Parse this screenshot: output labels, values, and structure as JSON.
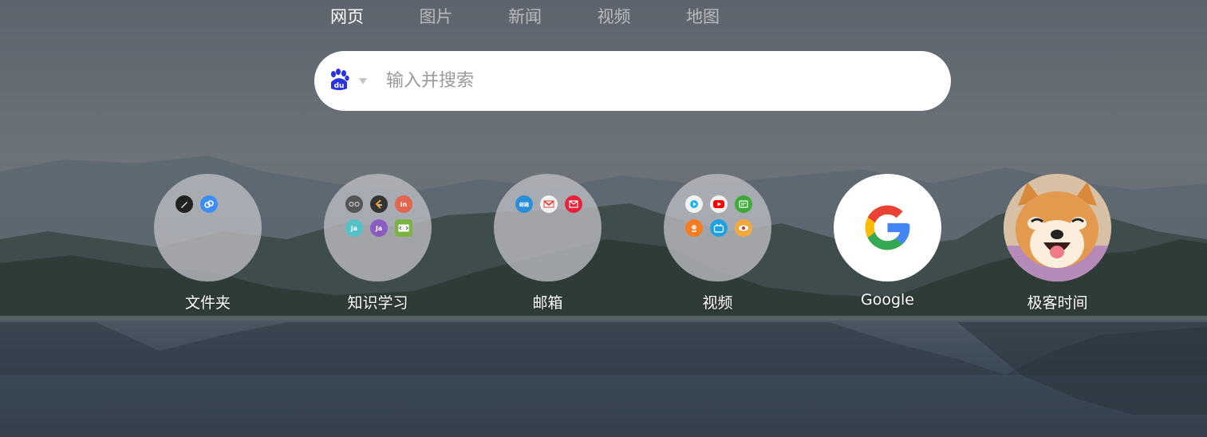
{
  "nav": {
    "tabs": [
      {
        "label": "网页",
        "active": true
      },
      {
        "label": "图片",
        "active": false
      },
      {
        "label": "新闻",
        "active": false
      },
      {
        "label": "视频",
        "active": false
      },
      {
        "label": "地图",
        "active": false
      }
    ]
  },
  "search": {
    "engine_icon": "baidu-paw-icon",
    "placeholder": "输入并搜索",
    "value": ""
  },
  "shortcuts": [
    {
      "label": "文件夹",
      "type": "folder",
      "icons": [
        "pen-icon",
        "cloud-link-icon"
      ]
    },
    {
      "label": "知识学习",
      "type": "folder",
      "icons": [
        "glasses-icon",
        "leetcode-icon",
        "in",
        "ja",
        "Ja",
        "code-icon"
      ],
      "mini_text": {
        "in": "in",
        "ja": "ja",
        "Ja": "Ja"
      }
    },
    {
      "label": "邮箱",
      "type": "folder",
      "icons": [
        "mail-163-icon",
        "gmail-icon",
        "mail-red-icon"
      ],
      "mini_text": {
        "mail-163": "邮箱"
      }
    },
    {
      "label": "视频",
      "type": "folder",
      "icons": [
        "youku-icon",
        "youtube-icon",
        "iqiyi-icon",
        "mgtv-icon",
        "bilibili-icon",
        "eye-icon"
      ]
    },
    {
      "label": "Google",
      "type": "site",
      "icons": [
        "google-icon"
      ]
    },
    {
      "label": "极客时间",
      "type": "site",
      "icons": [
        "shiba-avatar-icon"
      ]
    }
  ],
  "colors": {
    "accent_blue": "#2932e1",
    "google_blue": "#4285f4",
    "google_red": "#ea4335",
    "google_yellow": "#fbbc05",
    "google_green": "#34a853"
  }
}
